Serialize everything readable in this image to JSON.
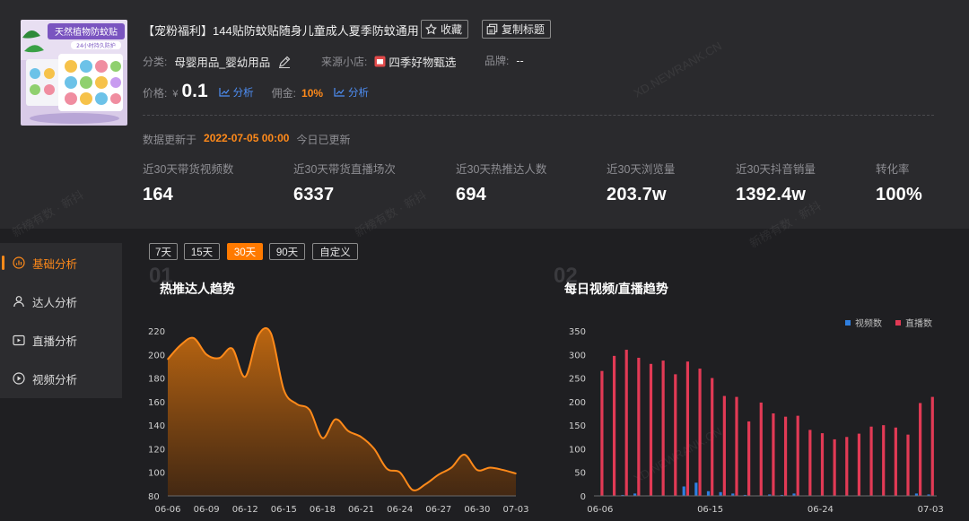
{
  "product": {
    "title": "【宠粉福利】144贴防蚊贴随身儿童成人夏季防蚊通用",
    "thumb_text": "天然植物防蚊贴",
    "thumb_sub": "24小时持久防护",
    "favorite_label": "收藏",
    "copy_title_label": "复制标题",
    "category_label": "分类:",
    "category_value": "母婴用品_婴幼用品",
    "shop_label": "来源小店:",
    "shop_value": "四季好物甄选",
    "brand_label": "品牌:",
    "brand_value": "--",
    "price_label": "价格:",
    "price_symbol": "¥",
    "price_value": "0.1",
    "analysis_label": "分析",
    "commission_label": "佣金:",
    "commission_value": "10%"
  },
  "update": {
    "label": "数据更新于",
    "time": "2022-07-05 00:00",
    "note": "今日已更新"
  },
  "stats": [
    {
      "label": "近30天带货视频数",
      "value": "164"
    },
    {
      "label": "近30天带货直播场次",
      "value": "6337"
    },
    {
      "label": "近30天热推达人数",
      "value": "694"
    },
    {
      "label": "近30天浏览量",
      "value": "203.7w"
    },
    {
      "label": "近30天抖音销量",
      "value": "1392.4w"
    },
    {
      "label": "转化率",
      "value": "100%"
    }
  ],
  "sidebar": {
    "items": [
      {
        "label": "基础分析",
        "icon": "bar-chart-icon",
        "active": true
      },
      {
        "label": "达人分析",
        "icon": "person-icon",
        "active": false
      },
      {
        "label": "直播分析",
        "icon": "tv-icon",
        "active": false
      },
      {
        "label": "视频分析",
        "icon": "play-icon",
        "active": false
      }
    ]
  },
  "ranges": [
    {
      "label": "7天",
      "active": false
    },
    {
      "label": "15天",
      "active": false
    },
    {
      "label": "30天",
      "active": true
    },
    {
      "label": "90天",
      "active": false
    },
    {
      "label": "自定义",
      "active": false
    }
  ],
  "colors": {
    "accent": "#ff7a00",
    "video_series": "#2f7fe0",
    "live_series": "#e23a55",
    "link": "#4e8ff5"
  },
  "watermarks": [
    "新榜有数 · 新抖",
    "XD.NEWRANK.CN"
  ],
  "chart_data": [
    {
      "type": "area",
      "number": "01",
      "title": "热推达人趋势",
      "x": [
        "06-06",
        "06-07",
        "06-08",
        "06-09",
        "06-10",
        "06-11",
        "06-12",
        "06-13",
        "06-14",
        "06-15",
        "06-16",
        "06-17",
        "06-18",
        "06-19",
        "06-20",
        "06-21",
        "06-22",
        "06-23",
        "06-24",
        "06-25",
        "06-26",
        "06-27",
        "06-28",
        "06-29",
        "06-30",
        "07-01",
        "07-02",
        "07-03"
      ],
      "xticks": [
        "06-06",
        "06-09",
        "06-12",
        "06-15",
        "06-18",
        "06-21",
        "06-24",
        "06-27",
        "06-30",
        "07-03"
      ],
      "series": [
        {
          "values": [
            196,
            208,
            214,
            200,
            197,
            205,
            181,
            216,
            218,
            170,
            158,
            153,
            129,
            145,
            135,
            130,
            120,
            103,
            100,
            85,
            90,
            98,
            104,
            115,
            102,
            104,
            102,
            99
          ]
        }
      ],
      "ylim": [
        80,
        220
      ],
      "yticks": [
        80,
        100,
        120,
        140,
        160,
        180,
        200,
        220
      ],
      "grid": false
    },
    {
      "type": "bar",
      "number": "02",
      "title": "每日视频/直播趋势",
      "x": [
        "06-06",
        "06-07",
        "06-08",
        "06-09",
        "06-10",
        "06-11",
        "06-12",
        "06-13",
        "06-14",
        "06-15",
        "06-16",
        "06-17",
        "06-18",
        "06-19",
        "06-20",
        "06-21",
        "06-22",
        "06-23",
        "06-24",
        "06-25",
        "06-26",
        "06-27",
        "06-28",
        "06-29",
        "06-30",
        "07-01",
        "07-02",
        "07-03"
      ],
      "xticks": [
        "06-06",
        "06-15",
        "06-24",
        "07-03"
      ],
      "series": [
        {
          "name": "视频数",
          "values": [
            1,
            1,
            2,
            5,
            1,
            1,
            1,
            20,
            28,
            10,
            8,
            5,
            2,
            1,
            3,
            2,
            5,
            1,
            1,
            1,
            1,
            1,
            1,
            1,
            1,
            1,
            5,
            3
          ]
        },
        {
          "name": "直播数",
          "values": [
            265,
            297,
            310,
            293,
            280,
            287,
            258,
            285,
            270,
            250,
            212,
            210,
            158,
            198,
            175,
            168,
            170,
            140,
            133,
            120,
            125,
            132,
            147,
            150,
            145,
            130,
            197,
            210
          ]
        }
      ],
      "ylim": [
        0,
        350
      ],
      "yticks": [
        0,
        50,
        100,
        150,
        200,
        250,
        300,
        350
      ],
      "legend": "top-right",
      "grid": false
    }
  ]
}
